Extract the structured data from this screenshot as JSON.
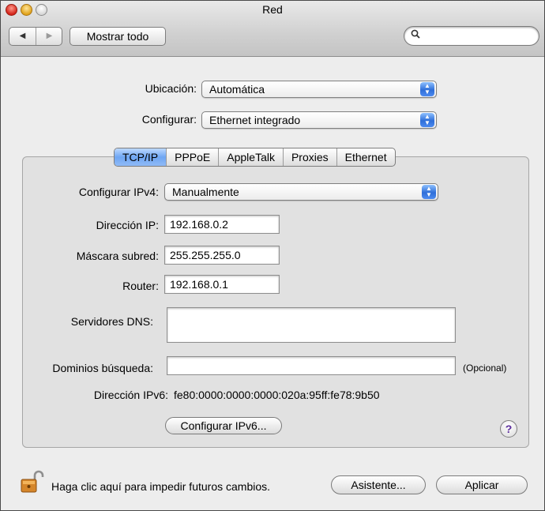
{
  "window": {
    "title": "Red"
  },
  "toolbar": {
    "back_glyph": "◀",
    "forward_glyph": "▶",
    "show_all_label": "Mostrar todo",
    "search_placeholder": "",
    "search_icon": "magnifier-icon"
  },
  "location": {
    "label": "Ubicación:",
    "value": "Automática"
  },
  "configure": {
    "label": "Configurar:",
    "value": "Ethernet integrado"
  },
  "tabs": [
    {
      "label": "TCP/IP",
      "active": true
    },
    {
      "label": "PPPoE",
      "active": false
    },
    {
      "label": "AppleTalk",
      "active": false
    },
    {
      "label": "Proxies",
      "active": false
    },
    {
      "label": "Ethernet",
      "active": false
    }
  ],
  "tcpip": {
    "ipv4_label": "Configurar IPv4:",
    "ipv4_value": "Manualmente",
    "ip_label": "Dirección IP:",
    "ip_value": "192.168.0.2",
    "mask_label": "Máscara subred:",
    "mask_value": "255.255.255.0",
    "router_label": "Router:",
    "router_value": "192.168.0.1",
    "dns_label": "Servidores DNS:",
    "dns_value": "",
    "search_domains_label": "Dominios búsqueda:",
    "search_domains_value": "",
    "optional_label": "(Opcional)",
    "ipv6_label": "Dirección IPv6:",
    "ipv6_value": "fe80:0000:0000:0000:020a:95ff:fe78:9b50",
    "configure_ipv6_button": "Configurar IPv6...",
    "help_glyph": "?"
  },
  "footer": {
    "lock_text": "Haga clic aquí para impedir futuros cambios.",
    "assistant_button": "Asistente...",
    "apply_button": "Aplicar"
  },
  "colors": {
    "accent": "#3a7be5",
    "tab_active": "#8fbaf6",
    "help_mark": "#5b2c9c"
  }
}
